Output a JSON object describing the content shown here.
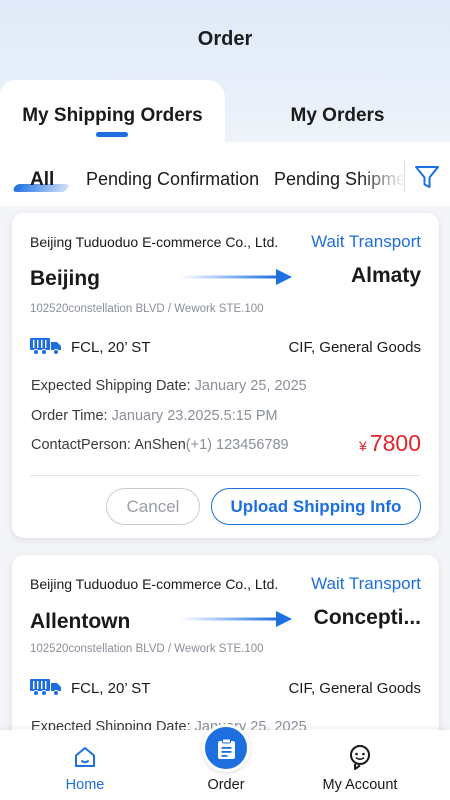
{
  "header": {
    "title": "Order"
  },
  "tabs": [
    {
      "label": "My Shipping Orders",
      "active": true
    },
    {
      "label": "My Orders",
      "active": false
    }
  ],
  "filters": [
    {
      "label": "All",
      "active": true
    },
    {
      "label": "Pending Confirmation",
      "active": false
    },
    {
      "label": "Pending Shipme",
      "active": false
    }
  ],
  "filter_icon": "funnel-icon",
  "orders": [
    {
      "company": "Beijing Tuduoduo E-commerce Co., Ltd.",
      "status": "Wait Transport",
      "origin": "Beijing",
      "destination": "Almaty",
      "address": "102520constellation BLVD  / Wework STE.100",
      "container": "FCL, 20’ ST",
      "goods": "CIF, General Goods",
      "shipping_date_label": "Expected Shipping Date:",
      "shipping_date": "January 25, 2025",
      "order_time_label": "Order Time:",
      "order_time": "January 23.2025.5:15 PM",
      "contact_label": "ContactPerson:",
      "contact_name": "AnShen",
      "contact_phone": "(+1) 123456789",
      "currency": "¥",
      "price": "7800",
      "cancel_label": "Cancel",
      "upload_label": "Upload Shipping Info"
    },
    {
      "company": "Beijing Tuduoduo E-commerce Co., Ltd.",
      "status": "Wait Transport",
      "origin": "Allentown",
      "destination": "Concepti...",
      "address": "102520constellation BLVD  / Wework STE.100",
      "container": "FCL, 20’ ST",
      "goods": "CIF, General Goods",
      "shipping_date_label": "Expected Shipping Date:",
      "shipping_date": "January 25, 2025"
    }
  ],
  "bottom_nav": [
    {
      "label": "Home",
      "icon": "home-icon",
      "active": true
    },
    {
      "label": "Order",
      "icon": "clipboard-icon",
      "active": false
    },
    {
      "label": "My Account",
      "icon": "user-icon",
      "active": false
    }
  ],
  "colors": {
    "accent": "#1d6fe0",
    "price": "#e0262b",
    "muted": "#8a8f99"
  }
}
